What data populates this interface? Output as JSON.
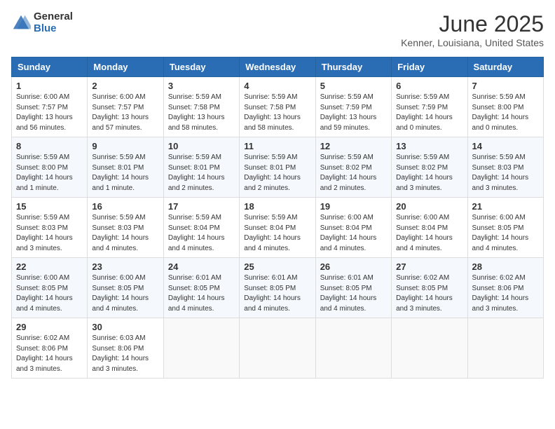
{
  "header": {
    "logo_general": "General",
    "logo_blue": "Blue",
    "month_title": "June 2025",
    "location": "Kenner, Louisiana, United States"
  },
  "weekdays": [
    "Sunday",
    "Monday",
    "Tuesday",
    "Wednesday",
    "Thursday",
    "Friday",
    "Saturday"
  ],
  "weeks": [
    [
      {
        "day": "1",
        "info": "Sunrise: 6:00 AM\nSunset: 7:57 PM\nDaylight: 13 hours\nand 56 minutes."
      },
      {
        "day": "2",
        "info": "Sunrise: 6:00 AM\nSunset: 7:57 PM\nDaylight: 13 hours\nand 57 minutes."
      },
      {
        "day": "3",
        "info": "Sunrise: 5:59 AM\nSunset: 7:58 PM\nDaylight: 13 hours\nand 58 minutes."
      },
      {
        "day": "4",
        "info": "Sunrise: 5:59 AM\nSunset: 7:58 PM\nDaylight: 13 hours\nand 58 minutes."
      },
      {
        "day": "5",
        "info": "Sunrise: 5:59 AM\nSunset: 7:59 PM\nDaylight: 13 hours\nand 59 minutes."
      },
      {
        "day": "6",
        "info": "Sunrise: 5:59 AM\nSunset: 7:59 PM\nDaylight: 14 hours\nand 0 minutes."
      },
      {
        "day": "7",
        "info": "Sunrise: 5:59 AM\nSunset: 8:00 PM\nDaylight: 14 hours\nand 0 minutes."
      }
    ],
    [
      {
        "day": "8",
        "info": "Sunrise: 5:59 AM\nSunset: 8:00 PM\nDaylight: 14 hours\nand 1 minute."
      },
      {
        "day": "9",
        "info": "Sunrise: 5:59 AM\nSunset: 8:01 PM\nDaylight: 14 hours\nand 1 minute."
      },
      {
        "day": "10",
        "info": "Sunrise: 5:59 AM\nSunset: 8:01 PM\nDaylight: 14 hours\nand 2 minutes."
      },
      {
        "day": "11",
        "info": "Sunrise: 5:59 AM\nSunset: 8:01 PM\nDaylight: 14 hours\nand 2 minutes."
      },
      {
        "day": "12",
        "info": "Sunrise: 5:59 AM\nSunset: 8:02 PM\nDaylight: 14 hours\nand 2 minutes."
      },
      {
        "day": "13",
        "info": "Sunrise: 5:59 AM\nSunset: 8:02 PM\nDaylight: 14 hours\nand 3 minutes."
      },
      {
        "day": "14",
        "info": "Sunrise: 5:59 AM\nSunset: 8:03 PM\nDaylight: 14 hours\nand 3 minutes."
      }
    ],
    [
      {
        "day": "15",
        "info": "Sunrise: 5:59 AM\nSunset: 8:03 PM\nDaylight: 14 hours\nand 3 minutes."
      },
      {
        "day": "16",
        "info": "Sunrise: 5:59 AM\nSunset: 8:03 PM\nDaylight: 14 hours\nand 4 minutes."
      },
      {
        "day": "17",
        "info": "Sunrise: 5:59 AM\nSunset: 8:04 PM\nDaylight: 14 hours\nand 4 minutes."
      },
      {
        "day": "18",
        "info": "Sunrise: 5:59 AM\nSunset: 8:04 PM\nDaylight: 14 hours\nand 4 minutes."
      },
      {
        "day": "19",
        "info": "Sunrise: 6:00 AM\nSunset: 8:04 PM\nDaylight: 14 hours\nand 4 minutes."
      },
      {
        "day": "20",
        "info": "Sunrise: 6:00 AM\nSunset: 8:04 PM\nDaylight: 14 hours\nand 4 minutes."
      },
      {
        "day": "21",
        "info": "Sunrise: 6:00 AM\nSunset: 8:05 PM\nDaylight: 14 hours\nand 4 minutes."
      }
    ],
    [
      {
        "day": "22",
        "info": "Sunrise: 6:00 AM\nSunset: 8:05 PM\nDaylight: 14 hours\nand 4 minutes."
      },
      {
        "day": "23",
        "info": "Sunrise: 6:00 AM\nSunset: 8:05 PM\nDaylight: 14 hours\nand 4 minutes."
      },
      {
        "day": "24",
        "info": "Sunrise: 6:01 AM\nSunset: 8:05 PM\nDaylight: 14 hours\nand 4 minutes."
      },
      {
        "day": "25",
        "info": "Sunrise: 6:01 AM\nSunset: 8:05 PM\nDaylight: 14 hours\nand 4 minutes."
      },
      {
        "day": "26",
        "info": "Sunrise: 6:01 AM\nSunset: 8:05 PM\nDaylight: 14 hours\nand 4 minutes."
      },
      {
        "day": "27",
        "info": "Sunrise: 6:02 AM\nSunset: 8:05 PM\nDaylight: 14 hours\nand 3 minutes."
      },
      {
        "day": "28",
        "info": "Sunrise: 6:02 AM\nSunset: 8:06 PM\nDaylight: 14 hours\nand 3 minutes."
      }
    ],
    [
      {
        "day": "29",
        "info": "Sunrise: 6:02 AM\nSunset: 8:06 PM\nDaylight: 14 hours\nand 3 minutes."
      },
      {
        "day": "30",
        "info": "Sunrise: 6:03 AM\nSunset: 8:06 PM\nDaylight: 14 hours\nand 3 minutes."
      },
      {
        "day": "",
        "info": ""
      },
      {
        "day": "",
        "info": ""
      },
      {
        "day": "",
        "info": ""
      },
      {
        "day": "",
        "info": ""
      },
      {
        "day": "",
        "info": ""
      }
    ]
  ]
}
